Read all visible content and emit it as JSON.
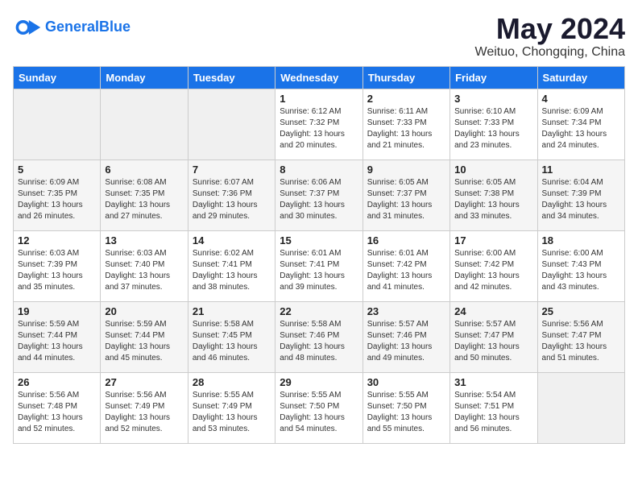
{
  "header": {
    "logo_general": "General",
    "logo_blue": "Blue",
    "month_year": "May 2024",
    "location": "Weituo, Chongqing, China"
  },
  "weekdays": [
    "Sunday",
    "Monday",
    "Tuesday",
    "Wednesday",
    "Thursday",
    "Friday",
    "Saturday"
  ],
  "weeks": [
    [
      {
        "day": "",
        "sunrise": "",
        "sunset": "",
        "daylight": ""
      },
      {
        "day": "",
        "sunrise": "",
        "sunset": "",
        "daylight": ""
      },
      {
        "day": "",
        "sunrise": "",
        "sunset": "",
        "daylight": ""
      },
      {
        "day": "1",
        "sunrise": "Sunrise: 6:12 AM",
        "sunset": "Sunset: 7:32 PM",
        "daylight": "Daylight: 13 hours and 20 minutes."
      },
      {
        "day": "2",
        "sunrise": "Sunrise: 6:11 AM",
        "sunset": "Sunset: 7:33 PM",
        "daylight": "Daylight: 13 hours and 21 minutes."
      },
      {
        "day": "3",
        "sunrise": "Sunrise: 6:10 AM",
        "sunset": "Sunset: 7:33 PM",
        "daylight": "Daylight: 13 hours and 23 minutes."
      },
      {
        "day": "4",
        "sunrise": "Sunrise: 6:09 AM",
        "sunset": "Sunset: 7:34 PM",
        "daylight": "Daylight: 13 hours and 24 minutes."
      }
    ],
    [
      {
        "day": "5",
        "sunrise": "Sunrise: 6:09 AM",
        "sunset": "Sunset: 7:35 PM",
        "daylight": "Daylight: 13 hours and 26 minutes."
      },
      {
        "day": "6",
        "sunrise": "Sunrise: 6:08 AM",
        "sunset": "Sunset: 7:35 PM",
        "daylight": "Daylight: 13 hours and 27 minutes."
      },
      {
        "day": "7",
        "sunrise": "Sunrise: 6:07 AM",
        "sunset": "Sunset: 7:36 PM",
        "daylight": "Daylight: 13 hours and 29 minutes."
      },
      {
        "day": "8",
        "sunrise": "Sunrise: 6:06 AM",
        "sunset": "Sunset: 7:37 PM",
        "daylight": "Daylight: 13 hours and 30 minutes."
      },
      {
        "day": "9",
        "sunrise": "Sunrise: 6:05 AM",
        "sunset": "Sunset: 7:37 PM",
        "daylight": "Daylight: 13 hours and 31 minutes."
      },
      {
        "day": "10",
        "sunrise": "Sunrise: 6:05 AM",
        "sunset": "Sunset: 7:38 PM",
        "daylight": "Daylight: 13 hours and 33 minutes."
      },
      {
        "day": "11",
        "sunrise": "Sunrise: 6:04 AM",
        "sunset": "Sunset: 7:39 PM",
        "daylight": "Daylight: 13 hours and 34 minutes."
      }
    ],
    [
      {
        "day": "12",
        "sunrise": "Sunrise: 6:03 AM",
        "sunset": "Sunset: 7:39 PM",
        "daylight": "Daylight: 13 hours and 35 minutes."
      },
      {
        "day": "13",
        "sunrise": "Sunrise: 6:03 AM",
        "sunset": "Sunset: 7:40 PM",
        "daylight": "Daylight: 13 hours and 37 minutes."
      },
      {
        "day": "14",
        "sunrise": "Sunrise: 6:02 AM",
        "sunset": "Sunset: 7:41 PM",
        "daylight": "Daylight: 13 hours and 38 minutes."
      },
      {
        "day": "15",
        "sunrise": "Sunrise: 6:01 AM",
        "sunset": "Sunset: 7:41 PM",
        "daylight": "Daylight: 13 hours and 39 minutes."
      },
      {
        "day": "16",
        "sunrise": "Sunrise: 6:01 AM",
        "sunset": "Sunset: 7:42 PM",
        "daylight": "Daylight: 13 hours and 41 minutes."
      },
      {
        "day": "17",
        "sunrise": "Sunrise: 6:00 AM",
        "sunset": "Sunset: 7:42 PM",
        "daylight": "Daylight: 13 hours and 42 minutes."
      },
      {
        "day": "18",
        "sunrise": "Sunrise: 6:00 AM",
        "sunset": "Sunset: 7:43 PM",
        "daylight": "Daylight: 13 hours and 43 minutes."
      }
    ],
    [
      {
        "day": "19",
        "sunrise": "Sunrise: 5:59 AM",
        "sunset": "Sunset: 7:44 PM",
        "daylight": "Daylight: 13 hours and 44 minutes."
      },
      {
        "day": "20",
        "sunrise": "Sunrise: 5:59 AM",
        "sunset": "Sunset: 7:44 PM",
        "daylight": "Daylight: 13 hours and 45 minutes."
      },
      {
        "day": "21",
        "sunrise": "Sunrise: 5:58 AM",
        "sunset": "Sunset: 7:45 PM",
        "daylight": "Daylight: 13 hours and 46 minutes."
      },
      {
        "day": "22",
        "sunrise": "Sunrise: 5:58 AM",
        "sunset": "Sunset: 7:46 PM",
        "daylight": "Daylight: 13 hours and 48 minutes."
      },
      {
        "day": "23",
        "sunrise": "Sunrise: 5:57 AM",
        "sunset": "Sunset: 7:46 PM",
        "daylight": "Daylight: 13 hours and 49 minutes."
      },
      {
        "day": "24",
        "sunrise": "Sunrise: 5:57 AM",
        "sunset": "Sunset: 7:47 PM",
        "daylight": "Daylight: 13 hours and 50 minutes."
      },
      {
        "day": "25",
        "sunrise": "Sunrise: 5:56 AM",
        "sunset": "Sunset: 7:47 PM",
        "daylight": "Daylight: 13 hours and 51 minutes."
      }
    ],
    [
      {
        "day": "26",
        "sunrise": "Sunrise: 5:56 AM",
        "sunset": "Sunset: 7:48 PM",
        "daylight": "Daylight: 13 hours and 52 minutes."
      },
      {
        "day": "27",
        "sunrise": "Sunrise: 5:56 AM",
        "sunset": "Sunset: 7:49 PM",
        "daylight": "Daylight: 13 hours and 52 minutes."
      },
      {
        "day": "28",
        "sunrise": "Sunrise: 5:55 AM",
        "sunset": "Sunset: 7:49 PM",
        "daylight": "Daylight: 13 hours and 53 minutes."
      },
      {
        "day": "29",
        "sunrise": "Sunrise: 5:55 AM",
        "sunset": "Sunset: 7:50 PM",
        "daylight": "Daylight: 13 hours and 54 minutes."
      },
      {
        "day": "30",
        "sunrise": "Sunrise: 5:55 AM",
        "sunset": "Sunset: 7:50 PM",
        "daylight": "Daylight: 13 hours and 55 minutes."
      },
      {
        "day": "31",
        "sunrise": "Sunrise: 5:54 AM",
        "sunset": "Sunset: 7:51 PM",
        "daylight": "Daylight: 13 hours and 56 minutes."
      },
      {
        "day": "",
        "sunrise": "",
        "sunset": "",
        "daylight": ""
      }
    ]
  ]
}
